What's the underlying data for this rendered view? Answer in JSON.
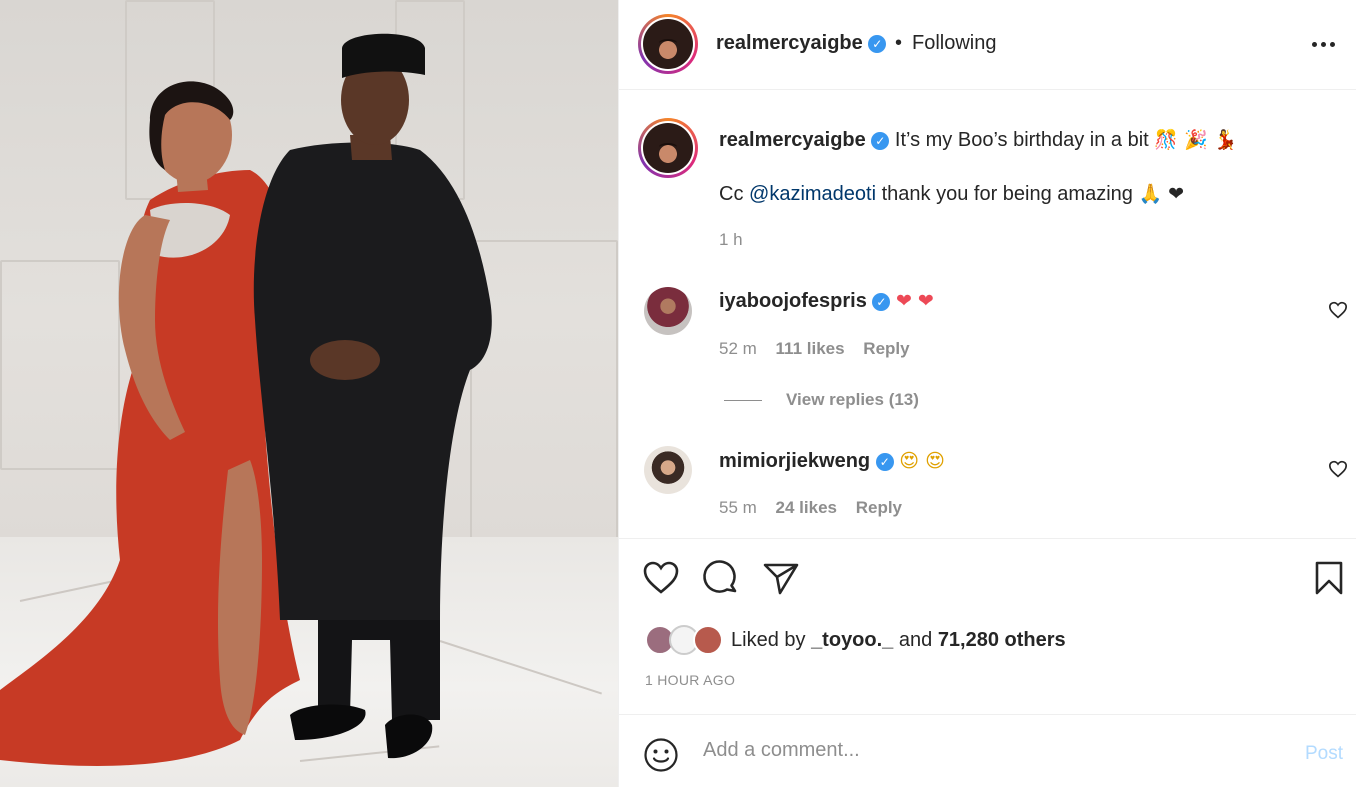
{
  "header": {
    "username": "realmercyaigbe",
    "separator": "•",
    "follow_status": "Following",
    "avatar_icon": "profile-avatar"
  },
  "caption": {
    "username": "realmercyaigbe",
    "text_line1": "It’s my Boo’s birthday in a bit",
    "emojis_line1": "🎊 🎉 💃",
    "cc_prefix": "Cc",
    "mention": "@kazimadeoti",
    "text_line2": "thank you for being amazing",
    "emojis_line2": "🙏 ❤",
    "time": "1 h"
  },
  "comments": [
    {
      "username": "iyaboojofespris",
      "text": "❤ ❤",
      "time": "52 m",
      "likes": "111 likes",
      "reply": "Reply"
    },
    {
      "username": "mimiorjiekweng",
      "text": "😍 😍",
      "time": "55 m",
      "likes": "24 likes",
      "reply": "Reply"
    }
  ],
  "view_replies": "View replies (13)",
  "likes": {
    "prefix": "Liked by",
    "first_user": "_toyoo._",
    "joiner": "and",
    "others": "71,280 others"
  },
  "timestamp": "1 HOUR AGO",
  "comment_box": {
    "placeholder": "Add a comment...",
    "post_label": "Post"
  },
  "colors": {
    "verified": "#3897f0",
    "mention": "#00376b",
    "muted": "#8e8e8e",
    "post_disabled": "#b3dbff",
    "heart_red": "#ed4956"
  }
}
